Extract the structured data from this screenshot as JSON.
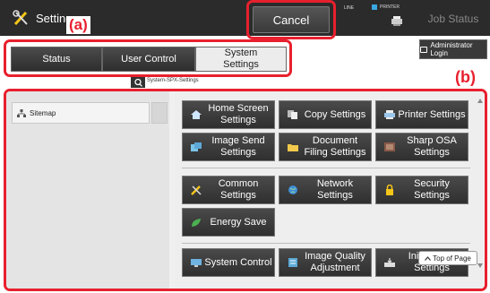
{
  "header": {
    "title": "Settings",
    "cancel_label": "Cancel",
    "line_label": "LINE",
    "printer_label": "PRINTER",
    "job_status_label": "Job Status"
  },
  "callouts": {
    "a": "(a)",
    "b": "(b)"
  },
  "tabs": [
    {
      "label": "Status"
    },
    {
      "label": "User Control"
    },
    {
      "label": "System\nSettings"
    }
  ],
  "admin_login_label": "Administrator Login",
  "path_text": "System-SPX-Settings",
  "sidebar": {
    "items": [
      {
        "label": "Sitemap"
      }
    ]
  },
  "menu": [
    {
      "label": "Home Screen Settings",
      "icon": "home-icon"
    },
    {
      "label": "Copy Settings",
      "icon": "copy-icon"
    },
    {
      "label": "Printer Settings",
      "icon": "printer-icon"
    },
    {
      "label": "Image Send Settings",
      "icon": "image-send-icon"
    },
    {
      "label": "Document Filing Settings",
      "icon": "folder-icon"
    },
    {
      "label": "Sharp OSA Settings",
      "icon": "osa-icon"
    },
    {
      "label": "Common Settings",
      "icon": "tools-icon"
    },
    {
      "label": "Network Settings",
      "icon": "globe-icon"
    },
    {
      "label": "Security Settings",
      "icon": "lock-icon"
    },
    {
      "label": "Energy Save",
      "icon": "leaf-icon"
    },
    {
      "label": "System Control",
      "icon": "monitor-icon"
    },
    {
      "label": "Image Quality Adjustment",
      "icon": "image-quality-icon"
    },
    {
      "label": "Init. Install. Settings",
      "icon": "install-icon"
    }
  ],
  "top_of_page_label": "Top of Page",
  "colors": {
    "callout": "#e8202e",
    "button_dark": "#333333",
    "header_bg": "#2b2b2b"
  }
}
